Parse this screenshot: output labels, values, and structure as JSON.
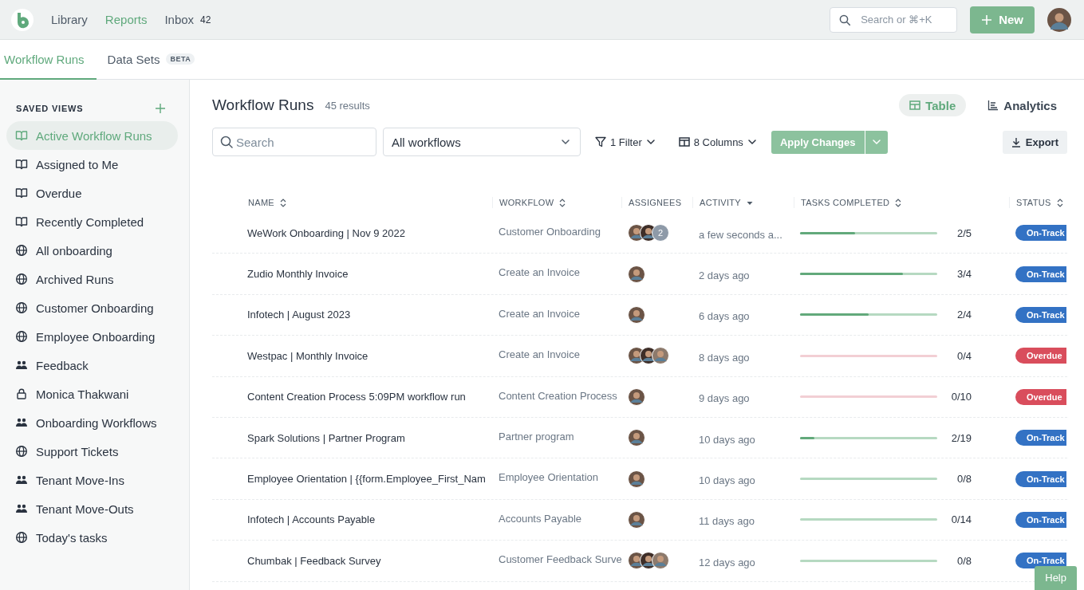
{
  "topbar": {
    "nav": [
      {
        "label": "Library",
        "selected": false
      },
      {
        "label": "Reports",
        "selected": true
      },
      {
        "label": "Inbox",
        "selected": false,
        "count": "42"
      }
    ],
    "search": {
      "placeholder": "Search or ⌘+K"
    },
    "new_button": "New"
  },
  "subtabs": [
    {
      "label": "Workflow Runs",
      "selected": true
    },
    {
      "label": "Data Sets",
      "selected": false,
      "badge": "BETA"
    }
  ],
  "sidebar": {
    "heading": "SAVED VIEWS",
    "items": [
      {
        "label": "Active Workflow Runs",
        "kind": "book",
        "selected": true
      },
      {
        "label": "Assigned to Me",
        "kind": "book",
        "selected": false
      },
      {
        "label": "Overdue",
        "kind": "book",
        "selected": false
      },
      {
        "label": "Recently Completed",
        "kind": "book",
        "selected": false
      },
      {
        "label": "All onboarding",
        "kind": "globe",
        "selected": false
      },
      {
        "label": "Archived Runs",
        "kind": "globe",
        "selected": false
      },
      {
        "label": "Customer Onboarding",
        "kind": "globe",
        "selected": false
      },
      {
        "label": "Employee Onboarding",
        "kind": "globe",
        "selected": false
      },
      {
        "label": "Feedback",
        "kind": "people",
        "selected": false
      },
      {
        "label": "Monica Thakwani",
        "kind": "lock",
        "selected": false
      },
      {
        "label": "Onboarding Workflows",
        "kind": "people",
        "selected": false
      },
      {
        "label": "Support Tickets",
        "kind": "globe",
        "selected": false
      },
      {
        "label": "Tenant Move-Ins",
        "kind": "people",
        "selected": false
      },
      {
        "label": "Tenant Move-Outs",
        "kind": "people",
        "selected": false
      },
      {
        "label": "Today's tasks",
        "kind": "globe",
        "selected": false
      }
    ]
  },
  "main": {
    "title": "Workflow Runs",
    "results": "45 results",
    "views": [
      {
        "label": "Table",
        "kind": "table",
        "selected": true
      },
      {
        "label": "Analytics",
        "kind": "analytics",
        "selected": false
      }
    ],
    "toolbar": {
      "search": {
        "placeholder": "Search"
      },
      "workflow_select": "All workflows",
      "filter": "1 Filter",
      "columns": "8 Columns",
      "apply": {
        "label": "Apply Changes",
        "disabled": true
      },
      "export": "Export"
    },
    "table": {
      "columns": [
        {
          "label": "NAME",
          "kind": "sortable"
        },
        {
          "label": "WORKFLOW",
          "kind": "sortable"
        },
        {
          "label": "ASSIGNEES",
          "kind": "plain"
        },
        {
          "label": "ACTIVITY",
          "kind": "descending"
        },
        {
          "label": "TASKS COMPLETED",
          "kind": "sortable"
        },
        {
          "label": "STATUS",
          "kind": "sortable"
        }
      ],
      "rows": [
        {
          "name": "WeWork Onboarding | Nov 9 2022",
          "workflow": "Customer Onboarding",
          "assignees": [
            {
              "kind": "avatar"
            },
            {
              "kind": "avatar"
            },
            {
              "kind": "more",
              "label": "2"
            }
          ],
          "activity": "a few seconds a...",
          "level": 0.4,
          "tasks": "2/5",
          "status": {
            "label": "On-Track",
            "kind": "on-track"
          }
        },
        {
          "name": "Zudio Monthly Invoice",
          "workflow": "Create an Invoice",
          "assignees": [
            {
              "kind": "avatar"
            }
          ],
          "activity": "2 days ago",
          "level": 0.75,
          "tasks": "3/4",
          "status": {
            "label": "On-Track",
            "kind": "on-track"
          }
        },
        {
          "name": "Infotech | August 2023",
          "workflow": "Create an Invoice",
          "assignees": [
            {
              "kind": "avatar"
            }
          ],
          "activity": "6 days ago",
          "level": 0.5,
          "tasks": "2/4",
          "status": {
            "label": "On-Track",
            "kind": "on-track"
          }
        },
        {
          "name": "Westpac | Monthly Invoice",
          "workflow": "Create an Invoice",
          "assignees": [
            {
              "kind": "avatar"
            },
            {
              "kind": "avatar"
            },
            {
              "kind": "avatar"
            }
          ],
          "activity": "8 days ago",
          "level": 0,
          "tasks": "0/4",
          "status": {
            "label": "Overdue",
            "kind": "overdue"
          }
        },
        {
          "name": "Content Creation Process 5:09PM workflow run",
          "workflow": "Content Creation Process",
          "assignees": [
            {
              "kind": "avatar"
            }
          ],
          "activity": "9 days ago",
          "level": 0,
          "tasks": "0/10",
          "status": {
            "label": "Overdue",
            "kind": "overdue"
          }
        },
        {
          "name": "Spark Solutions | Partner Program",
          "workflow": "Partner program",
          "assignees": [
            {
              "kind": "avatar"
            }
          ],
          "activity": "10 days ago",
          "level": 0.105,
          "tasks": "2/19",
          "status": {
            "label": "On-Track",
            "kind": "on-track"
          }
        },
        {
          "name": "Employee Orientation | {{form.Employee_First_Nam",
          "workflow": "Employee Orientation",
          "assignees": [
            {
              "kind": "avatar"
            }
          ],
          "activity": "10 days ago",
          "level": 0,
          "tasks": "0/8",
          "status": {
            "label": "On-Track",
            "kind": "on-track"
          }
        },
        {
          "name": "Infotech | Accounts Payable",
          "workflow": "Accounts Payable",
          "assignees": [
            {
              "kind": "avatar"
            }
          ],
          "activity": "11 days ago",
          "level": 0,
          "tasks": "0/14",
          "status": {
            "label": "On-Track",
            "kind": "on-track"
          }
        },
        {
          "name": "Chumbak | Feedback Survey",
          "workflow": "Customer Feedback Surve",
          "assignees": [
            {
              "kind": "avatar"
            },
            {
              "kind": "avatar"
            },
            {
              "kind": "avatar"
            }
          ],
          "activity": "12 days ago",
          "level": 0,
          "tasks": "0/8",
          "status": {
            "label": "On-Track",
            "kind": "on-track"
          }
        }
      ]
    }
  },
  "help_button": "Help"
}
